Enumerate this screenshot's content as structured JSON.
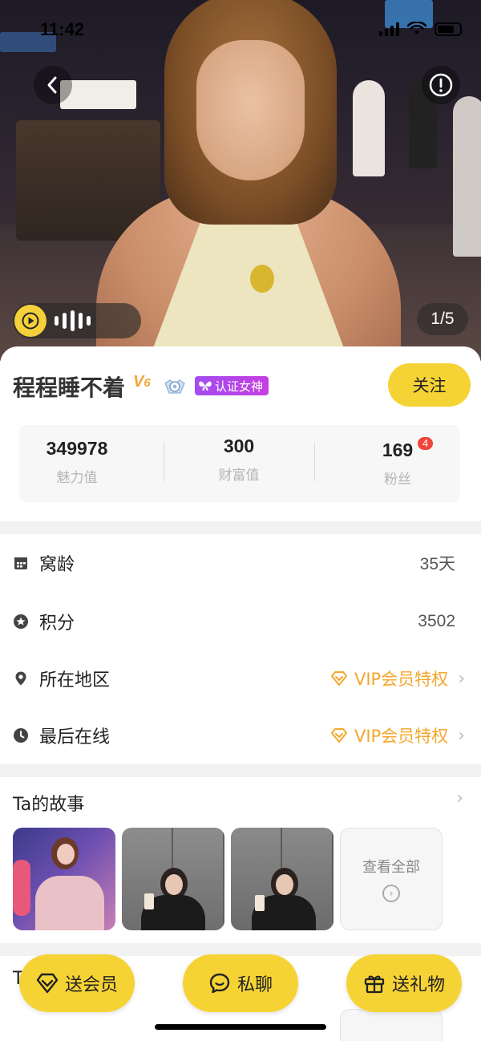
{
  "status_bar": {
    "time": "11:42"
  },
  "hero": {
    "photo_counter": "1/5"
  },
  "profile": {
    "name": "程程睡不着",
    "vip_level_letter": "V",
    "vip_level_number": "6",
    "verify_badge": "认证女神",
    "follow_label": "关注"
  },
  "stats": [
    {
      "value": "349978",
      "label": "魅力值"
    },
    {
      "value": "300",
      "label": "财富值"
    },
    {
      "value": "169",
      "label": "粉丝",
      "badge": "4"
    }
  ],
  "info": {
    "nest_age": {
      "label": "窝龄",
      "value": "35天"
    },
    "points": {
      "label": "积分",
      "value": "3502"
    },
    "region": {
      "label": "所在地区",
      "value": "VIP会员特权"
    },
    "last_online": {
      "label": "最后在线",
      "value": "VIP会员特权"
    }
  },
  "story": {
    "title": "Ta的故事",
    "view_all": "查看全部"
  },
  "next_section": {
    "title_partial": "T"
  },
  "actions": {
    "gift_vip": "送会员",
    "private_chat": "私聊",
    "send_gift": "送礼物"
  },
  "colors": {
    "accent": "#f6d335",
    "vip": "#f4a72c",
    "verify": "#b245e8",
    "badge": "#f0443a"
  }
}
